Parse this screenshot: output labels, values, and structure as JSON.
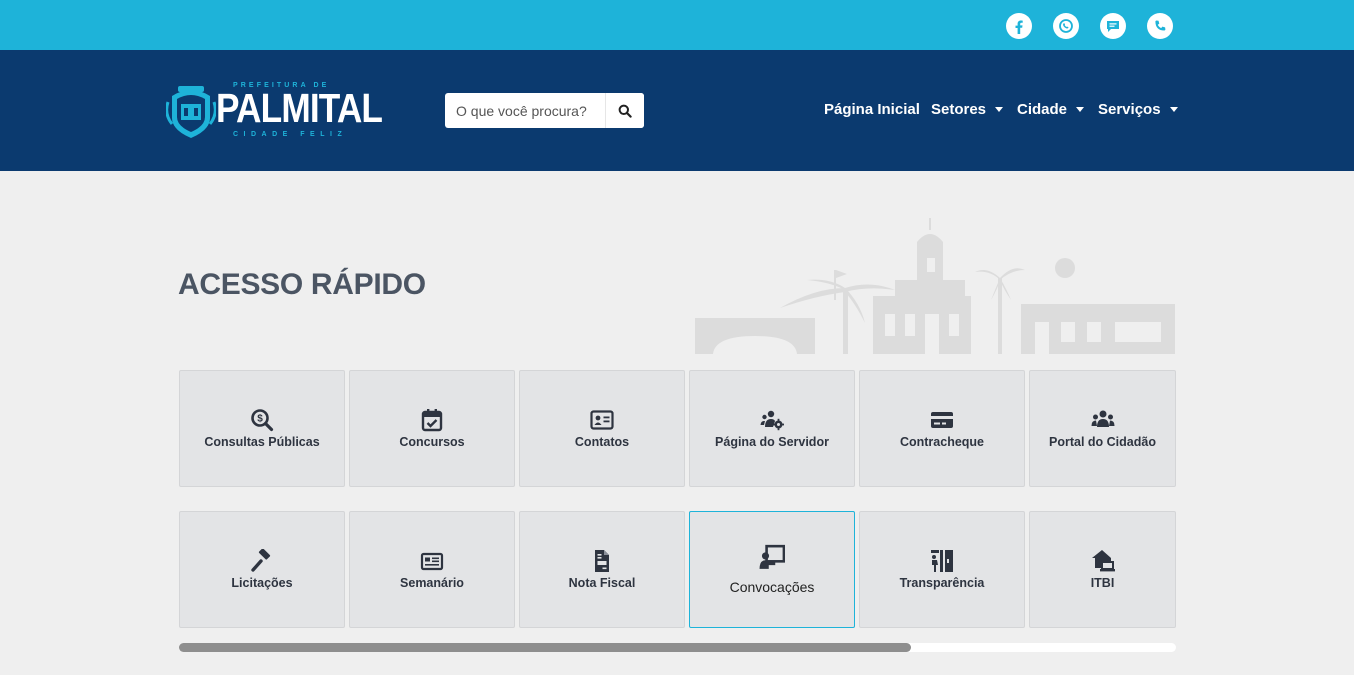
{
  "social": [
    {
      "name": "facebook",
      "icon": "facebook-icon"
    },
    {
      "name": "whatsapp",
      "icon": "whatsapp-icon"
    },
    {
      "name": "chat",
      "icon": "chat-icon"
    },
    {
      "name": "phone",
      "icon": "phone-icon"
    }
  ],
  "logo": {
    "top": "PREFEITURA DE",
    "main": "PALMITAL",
    "sub": "CIDADE FELIZ"
  },
  "search": {
    "placeholder": "O que você procura?",
    "icon": "search-icon"
  },
  "nav": {
    "home": "Página Inicial",
    "setores": "Setores",
    "cidade": "Cidade",
    "servicos": "Serviços"
  },
  "main": {
    "title": "ACESSO RÁPIDO",
    "tiles": [
      {
        "label": "Consultas Públicas",
        "icon": "search-dollar-icon"
      },
      {
        "label": "Concursos",
        "icon": "calendar-check-icon"
      },
      {
        "label": "Contatos",
        "icon": "id-card-icon"
      },
      {
        "label": "Página do Servidor",
        "icon": "users-cog-icon"
      },
      {
        "label": "Contracheque",
        "icon": "credit-card-icon"
      },
      {
        "label": "Portal do Cidadão",
        "icon": "users-icon"
      },
      {
        "label": "Licitações",
        "icon": "gavel-icon"
      },
      {
        "label": "Semanário",
        "icon": "newspaper-icon"
      },
      {
        "label": "Nota Fiscal",
        "icon": "file-invoice-icon"
      },
      {
        "label": "Convocações",
        "icon": "chalkboard-teacher-icon"
      },
      {
        "label": "Transparência",
        "icon": "person-booth-icon"
      },
      {
        "label": "ITBI",
        "icon": "house-laptop-icon"
      }
    ]
  },
  "scroll": {
    "fraction_visible": 0.73
  },
  "colors": {
    "topbar": "#1eb3d9",
    "header": "#0b3a6f",
    "accent": "#1eb3d9",
    "tile": "#e3e4e6",
    "title": "#4b5563"
  }
}
